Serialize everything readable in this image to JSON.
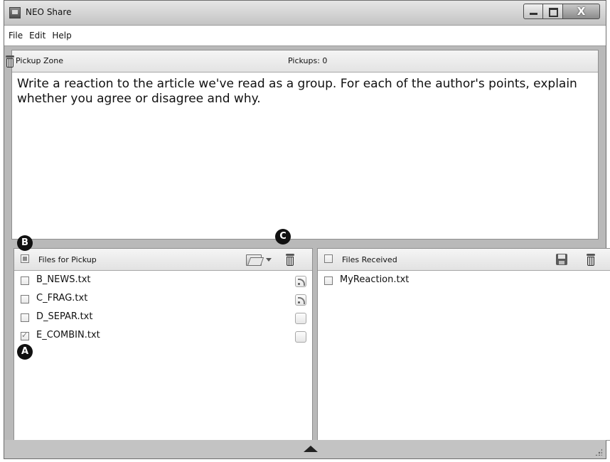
{
  "window": {
    "title": "NEO Share",
    "close_label": "X"
  },
  "menu": [
    "File",
    "Edit",
    "Help"
  ],
  "pickup_zone": {
    "title": "Pickup Zone",
    "pickups_label": "Pickups: 0",
    "text": "Write a reaction to the article we've read as a group. For each of the author's points, explain whether you agree or disagree and why."
  },
  "files_for_pickup": {
    "title": "Files for Pickup",
    "files": [
      {
        "name": "B_NEWS.txt",
        "checked": false,
        "icon": "rss-icon"
      },
      {
        "name": "C_FRAG.txt",
        "checked": false,
        "icon": "rss-icon"
      },
      {
        "name": "D_SEPAR.txt",
        "checked": false,
        "icon": "empty-icon"
      },
      {
        "name": "E_COMBIN.txt",
        "checked": true,
        "icon": "empty-icon"
      }
    ]
  },
  "files_received": {
    "title": "Files Received",
    "files": [
      {
        "name": "MyReaction.txt",
        "checked": false
      }
    ]
  },
  "markers": {
    "a": "A",
    "b": "B",
    "c": "C"
  }
}
